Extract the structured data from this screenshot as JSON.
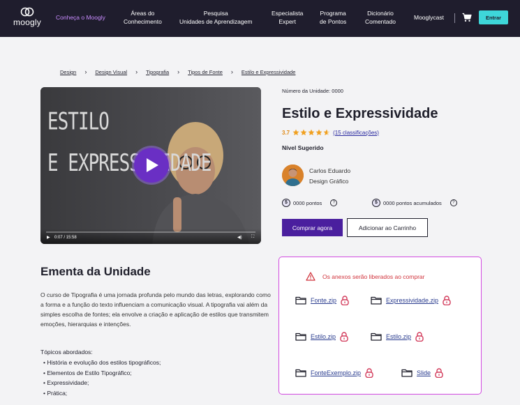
{
  "nav": {
    "logo_text": "moogly",
    "links": [
      {
        "label": "Conheça o Moogly"
      },
      {
        "label": "Áreas do\nConhecimento"
      },
      {
        "label": "Pesquisa\nUnidades de Aprendizagem"
      },
      {
        "label": "Especialista\nExpert"
      },
      {
        "label": "Programa\nde Pontos"
      },
      {
        "label": "Dicionário\nComentado"
      },
      {
        "label": "Mooglycast"
      }
    ],
    "login_label": "Entrar",
    "accent_color": "#c98cff",
    "button_color": "#3ed6d9"
  },
  "breadcrumb": [
    "Design",
    "Design Visual",
    "Tipografia",
    "Tipos de Fonte",
    "Estilo e Expressividade"
  ],
  "video": {
    "overlay_line1": "ESTILO",
    "overlay_line2": "E EXPRESSIVIDADE",
    "time": "0:07 / 15:58"
  },
  "unit": {
    "number_label": "Número da Unidade: 0000",
    "title": "Estilo e Expressividade",
    "rating": "3.7",
    "stars": 3.7,
    "rating_count": "(15 classificações)",
    "level_label": "Nível Sugerido",
    "author_name": "Carlos Eduardo",
    "author_area": "Design Gráfico",
    "points": "0000 pontos",
    "accumulated": "0000  pontos acumulados",
    "buy_label": "Comprar agora",
    "cart_label": "Adicionar ao Carrinho"
  },
  "ementa": {
    "title": "Ementa da Unidade",
    "text": "O curso de Tipografia é uma jornada profunda pelo mundo das letras, explorando como a forma e a função do texto influenciam a comunicação visual. A tipografia vai além da simples escolha de fontes; ela envolve a criação e aplicação de estilos que transmitem emoções, hierarquias e intenções.",
    "topics_title": "Tópicos abordados:",
    "topics": [
      "História e evolução dos estilos tipográficos;",
      "Elementos de Estilo Tipográfico;",
      "Expressividade;",
      "Prática;"
    ]
  },
  "attachments": {
    "warning": "Os anexos serão liberados ao comprar",
    "files": [
      {
        "name": "Fonte.zip"
      },
      {
        "name": "Expressividade.zip"
      },
      {
        "name": "Estilo.zip"
      },
      {
        "name": "Estilo.zip"
      },
      {
        "name": "FonteExemplo.zip"
      },
      {
        "name": "Slide"
      }
    ]
  }
}
